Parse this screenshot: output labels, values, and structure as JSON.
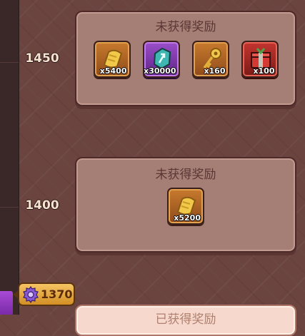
{
  "tiers": [
    {
      "points": "1450",
      "status": "未获得奖励",
      "rewards": [
        {
          "icon": "gold-scroll-icon",
          "count": "x5400"
        },
        {
          "icon": "teal-rune-stone-icon",
          "count": "x30000"
        },
        {
          "icon": "gold-key-icon",
          "count": "x160"
        },
        {
          "icon": "red-gift-box-icon",
          "count": "x100"
        }
      ]
    },
    {
      "points": "1400",
      "status": "未获得奖励",
      "rewards": [
        {
          "icon": "gold-scroll-icon",
          "count": "x5200"
        }
      ]
    },
    {
      "status": "已获得奖励"
    }
  ],
  "current": {
    "icon": "purple-gear-icon",
    "value": "1370"
  },
  "colors": {
    "panel": "#a57e76",
    "claimed_panel": "#f6d9cc",
    "badge": "#f0b548",
    "background": "#6b4440"
  }
}
